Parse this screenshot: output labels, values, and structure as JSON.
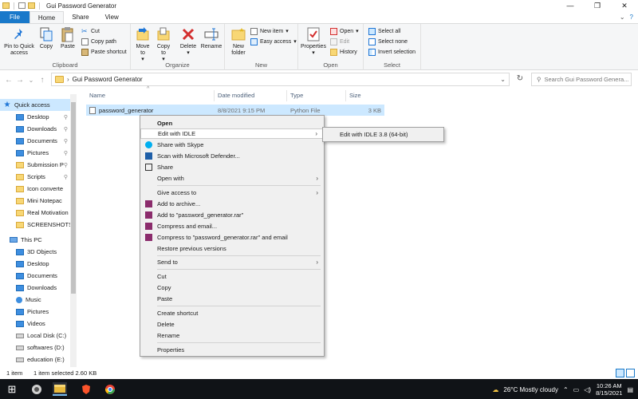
{
  "window": {
    "title": "Gui Password Generator",
    "controls": [
      "—",
      "❐",
      "✕"
    ]
  },
  "tabs": {
    "file": "File",
    "home": "Home",
    "share": "Share",
    "view": "View"
  },
  "ribbon": {
    "clipboard": {
      "name": "Clipboard",
      "pin": "Pin to Quick access",
      "copy": "Copy",
      "paste": "Paste",
      "cut": "Cut",
      "copy_path": "Copy path",
      "paste_shortcut": "Paste shortcut"
    },
    "organize": {
      "name": "Organize",
      "move_to": "Move to",
      "copy_to": "Copy to",
      "delete": "Delete",
      "rename": "Rename"
    },
    "new": {
      "name": "New",
      "new_folder": "New folder",
      "new_item": "New item",
      "easy_access": "Easy access"
    },
    "open": {
      "name": "Open",
      "properties": "Properties",
      "open": "Open",
      "edit": "Edit",
      "history": "History"
    },
    "select": {
      "name": "Select",
      "select_all": "Select all",
      "select_none": "Select none",
      "invert": "Invert selection"
    }
  },
  "address": {
    "path": "Gui Password Generator",
    "search_placeholder": "Search Gui Password Genera..."
  },
  "nav": {
    "quick_access": "Quick access",
    "quick_items": [
      "Desktop",
      "Downloads",
      "Documents",
      "Pictures",
      "Submission P",
      "Scripts",
      "Icon converte",
      "Mini Notepac",
      "Real Motivation",
      "SCREENSHOTS"
    ],
    "this_pc": "This PC",
    "pc_items": [
      "3D Objects",
      "Desktop",
      "Documents",
      "Downloads",
      "Music",
      "Pictures",
      "Videos",
      "Local Disk (C:)",
      "softwares (D:)",
      "education (E:)"
    ]
  },
  "columns": {
    "name": "Name",
    "date": "Date modified",
    "type": "Type",
    "size": "Size"
  },
  "file": {
    "name": "password_generator",
    "date": "8/8/2021 9:15 PM",
    "type": "Python File",
    "size": "3 KB"
  },
  "context_menu": {
    "open": "Open",
    "edit_idle": "Edit with IDLE",
    "skype": "Share with Skype",
    "defender": "Scan with Microsoft Defender...",
    "share": "Share",
    "open_with": "Open with",
    "give_access": "Give access to",
    "add_archive": "Add to archive...",
    "add_rar": "Add to \"password_generator.rar\"",
    "compress_email": "Compress and email...",
    "compress_rar_email": "Compress to \"password_generator.rar\" and email",
    "restore": "Restore previous versions",
    "send_to": "Send to",
    "cut": "Cut",
    "copy": "Copy",
    "paste": "Paste",
    "create_shortcut": "Create shortcut",
    "delete": "Delete",
    "rename": "Rename",
    "properties": "Properties"
  },
  "submenu": {
    "edit_idle_38": "Edit with IDLE 3.8 (64-bit)"
  },
  "status": {
    "count": "1 item",
    "selected": "1 item selected  2.60 KB"
  },
  "taskbar": {
    "weather": "26°C  Mostly cloudy",
    "time": "10:26 AM",
    "date": "8/15/2021"
  }
}
